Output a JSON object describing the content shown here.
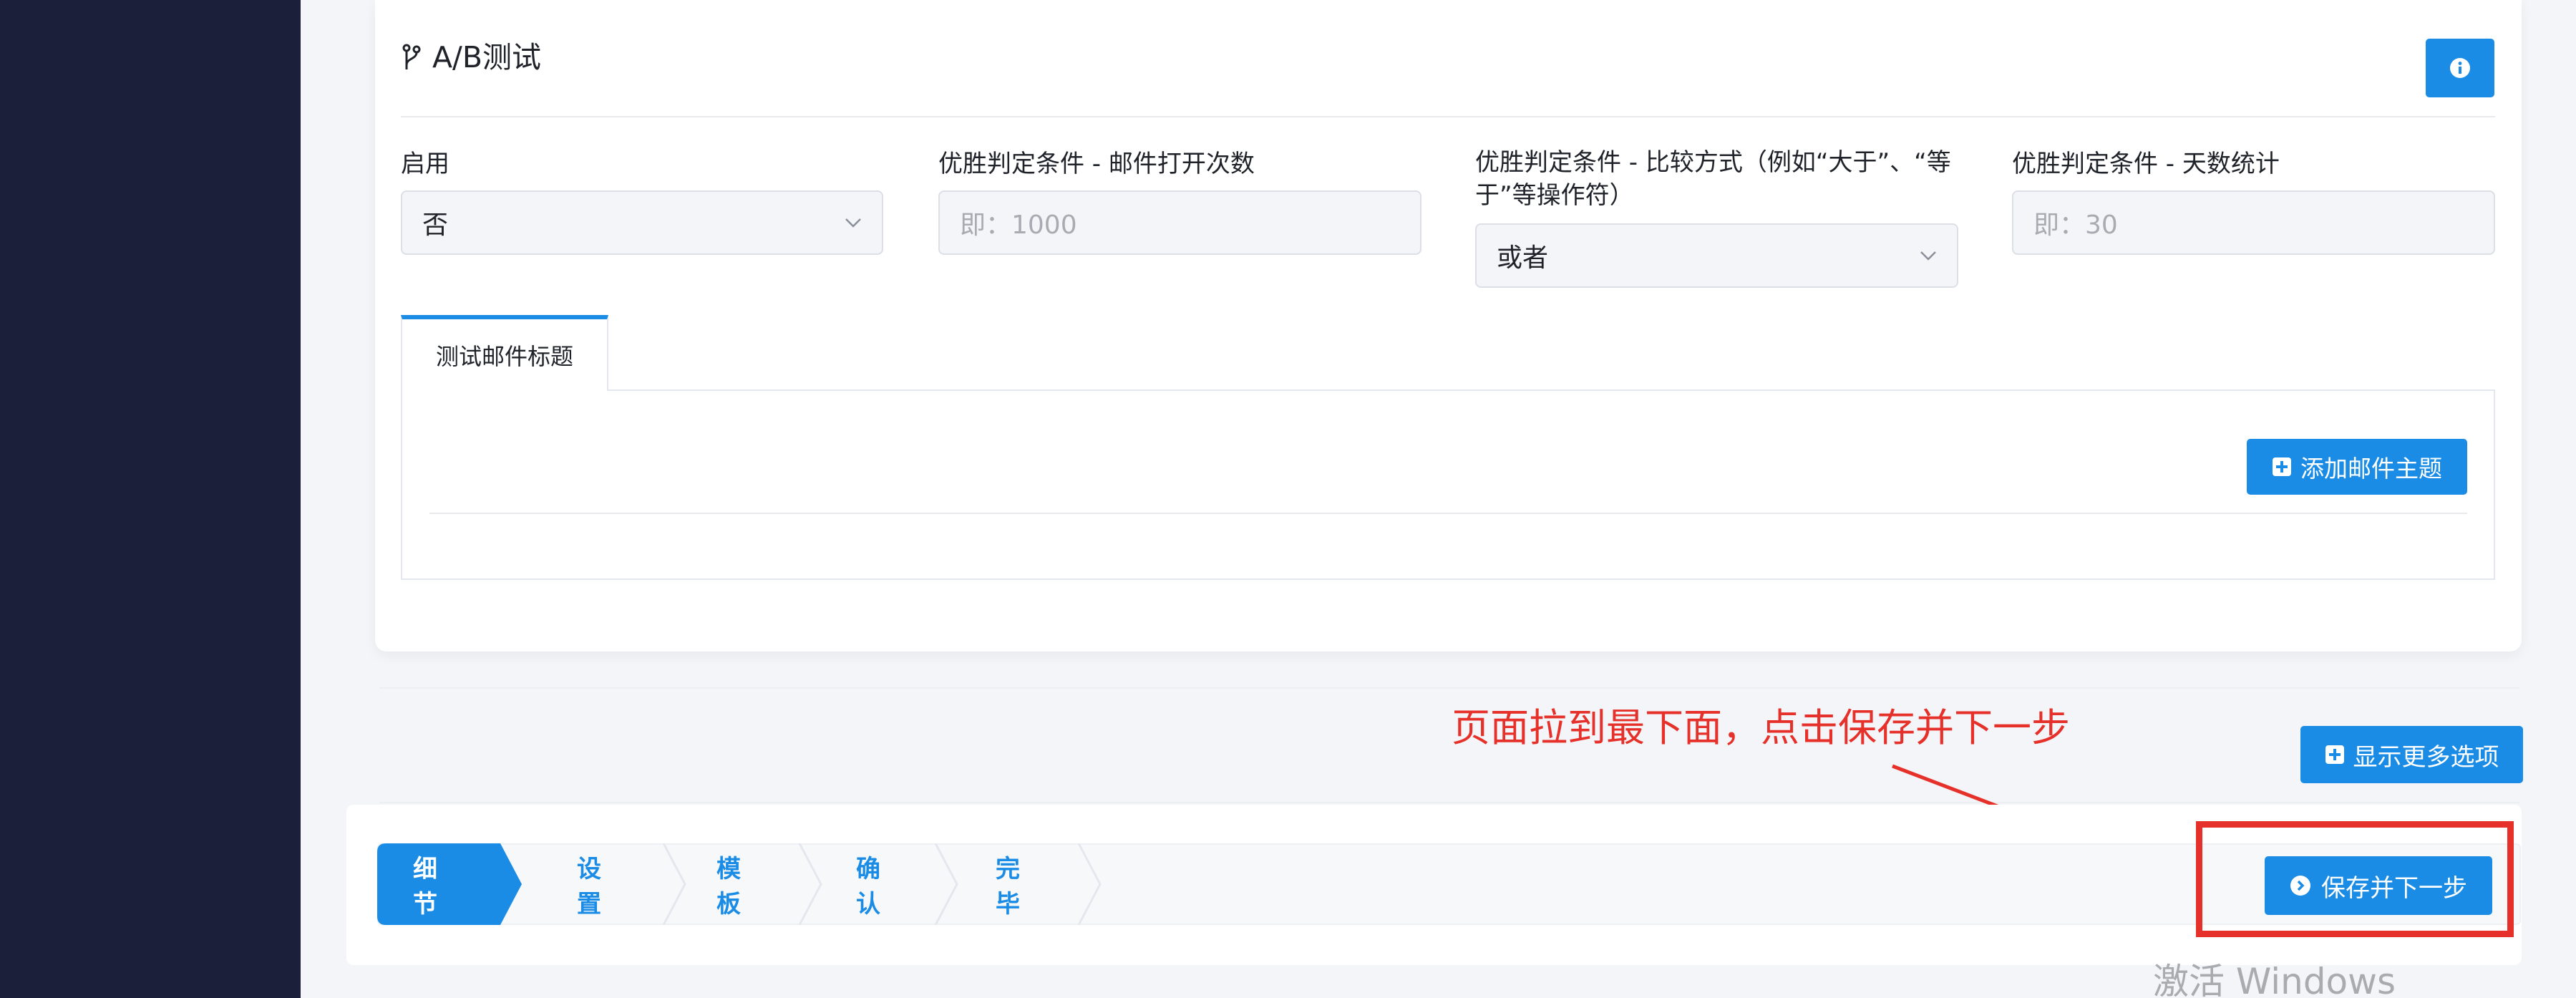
{
  "section": {
    "title": "A/B测试",
    "title_icon": "branch-icon",
    "info_icon": "info-circle-icon"
  },
  "fields": {
    "enable": {
      "label": "启用",
      "value": "否"
    },
    "open_count": {
      "label": "优胜判定条件 - 邮件打开次数",
      "placeholder": "即：1000"
    },
    "compare": {
      "label_line1": "优胜判定条件 - 比较方式（例如“大于”、“等",
      "label_line2": "于”等操作符）",
      "value": "或者"
    },
    "days": {
      "label": "优胜判定条件 - 天数统计",
      "placeholder": "即：30"
    }
  },
  "tabs": [
    {
      "label": "测试邮件标题"
    }
  ],
  "tab_panel": {
    "add_button_label": "添加邮件主题",
    "add_icon": "plus-square-icon"
  },
  "annotation": {
    "text": "页面拉到最下面，点击保存并下一步"
  },
  "more_options": {
    "label": "显示更多选项",
    "icon": "plus-square-icon"
  },
  "steps": [
    {
      "label": "细节",
      "active": true
    },
    {
      "label": "设置",
      "active": false
    },
    {
      "label": "模板",
      "active": false
    },
    {
      "label": "确认",
      "active": false
    },
    {
      "label": "完毕",
      "active": false
    }
  ],
  "save_next": {
    "label": "保存并下一步",
    "icon": "chevron-right-circle-icon"
  },
  "watermark": {
    "text": "激活 Windows"
  },
  "colors": {
    "accent": "#1a8ce6",
    "sidebar": "#1b1f3a",
    "annotation": "#e6302a"
  }
}
